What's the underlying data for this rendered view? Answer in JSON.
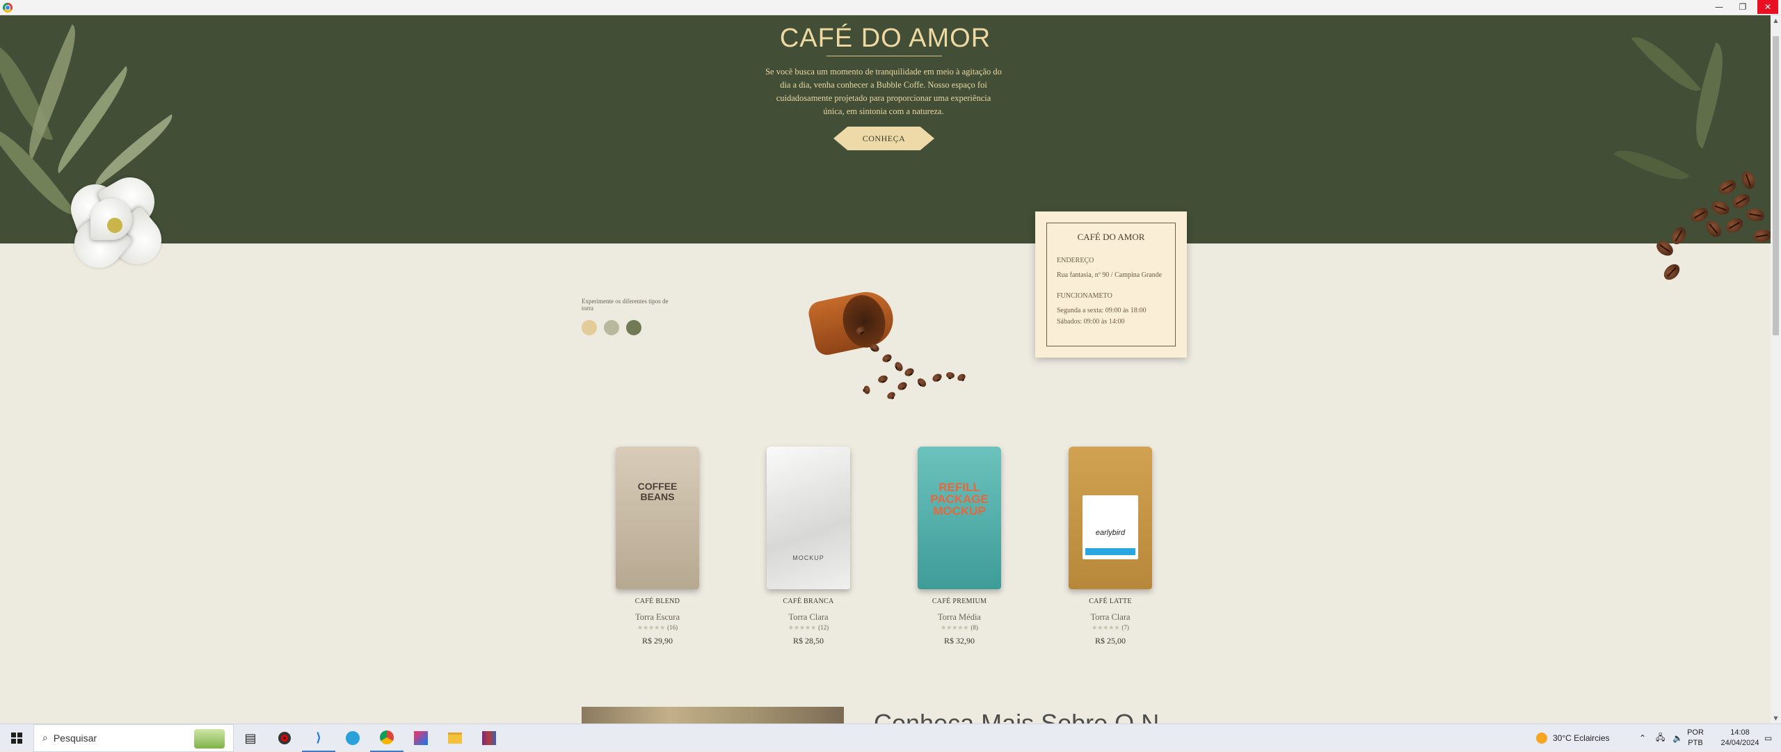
{
  "window": {
    "minimize": "—",
    "restore": "❐",
    "close": "✕"
  },
  "hero": {
    "title": "CAFÉ DO AMOR",
    "text": "Se você busca um momento de tranquilidade em meio à agitação do dia a dia, venha conhecer a Bubble Coffe. Nosso espaço foi cuidadosamente projetado para proporcionar uma experiência única, em sintonia com a natureza.",
    "cta_label": "CONHEÇA"
  },
  "info_card": {
    "title": "CAFÉ DO AMOR",
    "address_label": "ENDEREÇO",
    "address": "Rua fantasia, nº 90 / Campina Grande",
    "hours_label": "FUNCIONAMETO",
    "hours_weekdays": "Segunda a sexta: 09:00 às 18:00",
    "hours_saturday": "Sábados: 09:00 às 14:00"
  },
  "roast_selector": {
    "label": "Experimente os diferentes tipos de torra",
    "swatches": [
      "#e3cc98",
      "#b8b89c",
      "#707b55"
    ]
  },
  "products": [
    {
      "name": "CAFÉ BLEND",
      "roast": "Torra Escura",
      "stars": "★★★★★",
      "reviews": "(16)",
      "price": "R$ 29,90",
      "pack_text": "COFFEE BEANS"
    },
    {
      "name": "CAFÉ BRANCA",
      "roast": "Torra Clara",
      "stars": "★★★★★",
      "reviews": "(12)",
      "price": "R$ 28,50",
      "pack_text": "MOCKUP"
    },
    {
      "name": "CAFÉ PREMIUM",
      "roast": "Torra Média",
      "stars": "★★★★★",
      "reviews": "(8)",
      "price": "R$ 32,90",
      "pack_text": "REFILL PACKAGE MOCKUP"
    },
    {
      "name": "CAFÉ LATTE",
      "roast": "Torra Clara",
      "stars": "★★★★★",
      "reviews": "(7)",
      "price": "R$ 25,00",
      "pack_text": "earlybird"
    }
  ],
  "bottom": {
    "heading": "Conheça Mais Sobre O N"
  },
  "taskbar": {
    "search_placeholder": "Pesquisar",
    "weather": "30°C  Eclaircies",
    "lang_top": "POR",
    "lang_bottom": "PTB",
    "time": "14:08",
    "date": "24/04/2024"
  }
}
